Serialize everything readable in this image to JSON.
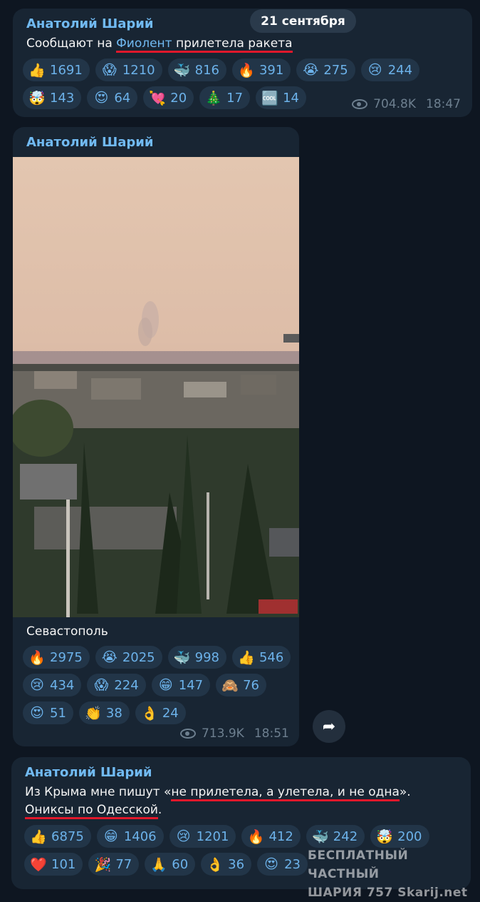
{
  "date_badge": "21 сентября",
  "posts": [
    {
      "author": "Анатолий Шарий",
      "text_before": "Сообщают на ",
      "link_text": "Фиолент",
      "text_after": " прилетела ракета",
      "views": "704.8K",
      "time": "18:47",
      "reactions": [
        [
          {
            "emoji": "👍",
            "icon": "thumbs-up-icon",
            "count": "1691"
          },
          {
            "emoji": "😱",
            "icon": "screaming-face-icon",
            "count": "1210"
          },
          {
            "emoji": "🐳",
            "icon": "whale-icon",
            "count": "816"
          },
          {
            "emoji": "🔥",
            "icon": "fire-icon",
            "count": "391"
          },
          {
            "emoji": "😭",
            "icon": "loudly-crying-face-icon",
            "count": "275"
          },
          {
            "emoji": "😢",
            "icon": "crying-face-icon",
            "count": "244"
          }
        ],
        [
          {
            "emoji": "🤯",
            "icon": "exploding-head-icon",
            "count": "143"
          },
          {
            "emoji": "😍",
            "icon": "heart-eyes-icon",
            "count": "64"
          },
          {
            "emoji": "💘",
            "icon": "heart-arrow-icon",
            "count": "20"
          },
          {
            "emoji": "🎄",
            "icon": "christmas-tree-icon",
            "count": "17"
          },
          {
            "emoji": "🆒",
            "icon": "cool-icon",
            "count": "14"
          }
        ]
      ]
    },
    {
      "author": "Анатолий Шарий",
      "caption": "Севастополь",
      "views": "713.9K",
      "time": "18:51",
      "reactions": [
        [
          {
            "emoji": "🔥",
            "icon": "fire-icon",
            "count": "2975"
          },
          {
            "emoji": "😭",
            "icon": "loudly-crying-face-icon",
            "count": "2025"
          },
          {
            "emoji": "🐳",
            "icon": "whale-icon",
            "count": "998"
          },
          {
            "emoji": "👍",
            "icon": "thumbs-up-icon",
            "count": "546"
          }
        ],
        [
          {
            "emoji": "😢",
            "icon": "crying-face-icon",
            "count": "434"
          },
          {
            "emoji": "😱",
            "icon": "screaming-face-icon",
            "count": "224"
          },
          {
            "emoji": "😁",
            "icon": "grinning-face-icon",
            "count": "147"
          },
          {
            "emoji": "🙈",
            "icon": "see-no-evil-monkey-icon",
            "count": "76"
          }
        ],
        [
          {
            "emoji": "😍",
            "icon": "heart-eyes-icon",
            "count": "51"
          },
          {
            "emoji": "👏",
            "icon": "clapping-hands-icon",
            "count": "38"
          },
          {
            "emoji": "👌",
            "icon": "ok-hand-icon",
            "count": "24"
          }
        ]
      ]
    },
    {
      "author": "Анатолий Шарий",
      "line1_before": "Из Крыма мне пишут «",
      "line1_quote": "не прилетела, а улетела, и не одна",
      "line1_after": "».",
      "line2": "Ониксы по Одесской",
      "line2_after": ".",
      "reactions": [
        [
          {
            "emoji": "👍",
            "icon": "thumbs-up-icon",
            "count": "6875"
          },
          {
            "emoji": "😁",
            "icon": "grinning-face-icon",
            "count": "1406"
          },
          {
            "emoji": "😢",
            "icon": "crying-face-icon",
            "count": "1201"
          },
          {
            "emoji": "🔥",
            "icon": "fire-icon",
            "count": "412"
          },
          {
            "emoji": "🐳",
            "icon": "whale-icon",
            "count": "242"
          },
          {
            "emoji": "🤯",
            "icon": "exploding-head-icon",
            "count": "200"
          }
        ],
        [
          {
            "emoji": "❤️",
            "icon": "red-heart-icon",
            "count": "101"
          },
          {
            "emoji": "🎉",
            "icon": "party-popper-icon",
            "count": "77"
          },
          {
            "emoji": "🙏",
            "icon": "folded-hands-icon",
            "count": "60"
          },
          {
            "emoji": "👌",
            "icon": "ok-hand-icon",
            "count": "36"
          },
          {
            "emoji": "😍",
            "icon": "heart-eyes-icon",
            "count": "23"
          }
        ]
      ]
    }
  ],
  "watermark": {
    "line1": "БЕСПЛАТНЫЙ ЧАСТНЫЙ",
    "line2": "ШАРИЯ 757 Skarij.net"
  },
  "share_icon": "forward-arrow-icon"
}
